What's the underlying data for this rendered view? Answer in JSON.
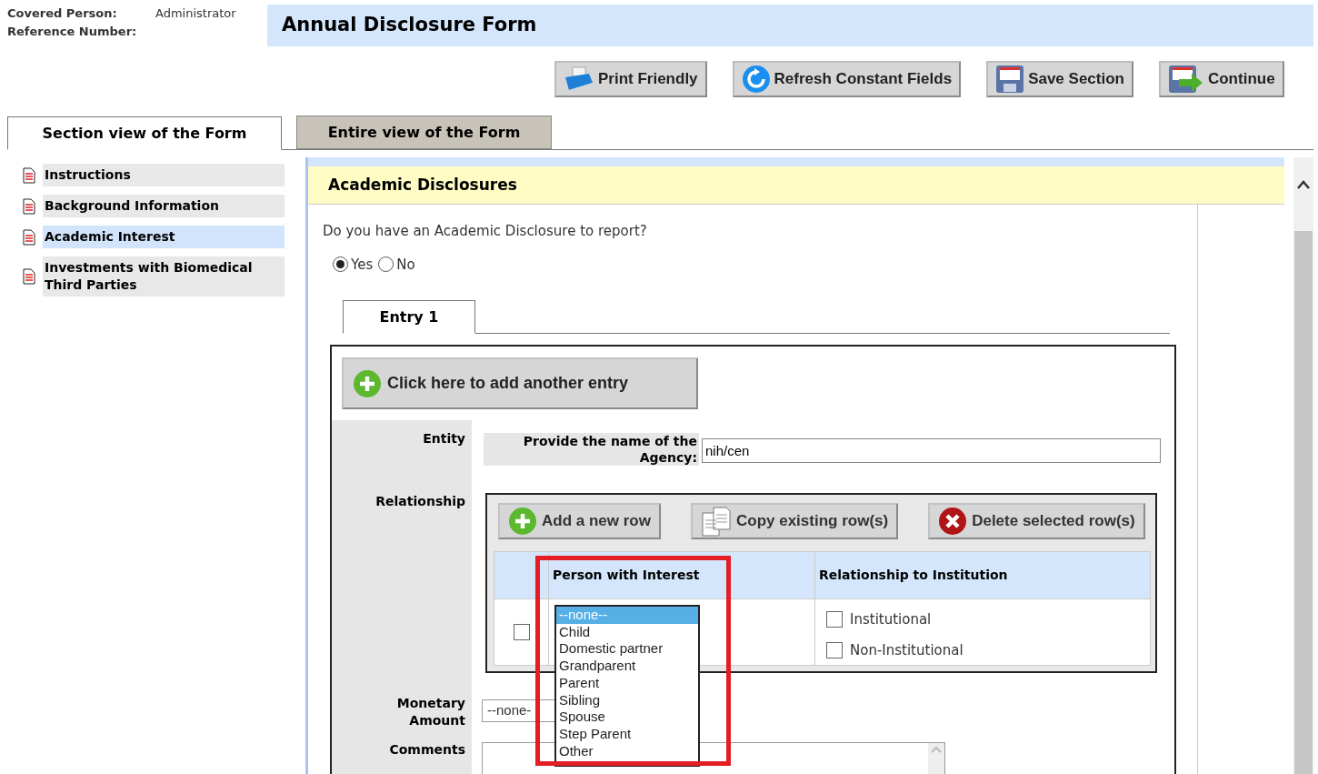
{
  "header": {
    "covered_person_label": "Covered Person:",
    "covered_person_value": "Administrator",
    "reference_label": "Reference Number:",
    "title": "Annual Disclosure Form"
  },
  "toolbar": [
    {
      "label": "Print Friendly",
      "kind": "print"
    },
    {
      "label": "Refresh Constant Fields",
      "kind": "refresh"
    },
    {
      "label": "Save Section",
      "kind": "save"
    },
    {
      "label": "Continue",
      "kind": "continue"
    }
  ],
  "view_tabs": [
    {
      "label": "Section view of the Form",
      "selected": true
    },
    {
      "label": "Entire view of the Form",
      "selected": false
    }
  ],
  "sidebar": {
    "items": [
      {
        "label": "Instructions",
        "selected": false
      },
      {
        "label": "Background Information",
        "selected": false
      },
      {
        "label": "Academic Interest",
        "selected": true
      },
      {
        "label": "Investments with Biomedical Third Parties",
        "selected": false
      }
    ]
  },
  "section": {
    "title": "Academic Disclosures",
    "question": "Do you have an Academic Disclosure to report?",
    "options": [
      {
        "label": "Yes",
        "selected": true
      },
      {
        "label": "No",
        "selected": false
      }
    ],
    "entry_tabs": [
      {
        "label": "Entry 1",
        "selected": true
      }
    ],
    "add_entry_button": "Click here to add another entry",
    "entity_label": "Entity",
    "agency_label": "Provide the name of the Agency:",
    "agency_value": "nih/cen",
    "relationship_label": "Relationship",
    "relationship_buttons": [
      {
        "label": "Add a new row",
        "kind": "add"
      },
      {
        "label": "Copy existing row(s)",
        "kind": "copy"
      },
      {
        "label": "Delete selected row(s)",
        "kind": "delete"
      }
    ],
    "table": {
      "columns": [
        "Person with Interest",
        "Relationship to Institution"
      ],
      "rows": [
        {
          "checked": false,
          "person_options": [
            {
              "label": "--none--",
              "selected": true
            },
            {
              "label": "Child",
              "selected": false
            },
            {
              "label": "Domestic partner",
              "selected": false
            },
            {
              "label": "Grandparent",
              "selected": false
            },
            {
              "label": "Parent",
              "selected": false
            },
            {
              "label": "Sibling",
              "selected": false
            },
            {
              "label": "Spouse",
              "selected": false
            },
            {
              "label": "Step Parent",
              "selected": false
            },
            {
              "label": "Other",
              "selected": false
            }
          ],
          "relationship_options": [
            {
              "label": "Institutional",
              "checked": false
            },
            {
              "label": "Non-Institutional",
              "checked": false
            }
          ]
        }
      ]
    },
    "monetary_label": "Monetary Amount",
    "monetary_value": "--none-",
    "comments_label": "Comments"
  }
}
